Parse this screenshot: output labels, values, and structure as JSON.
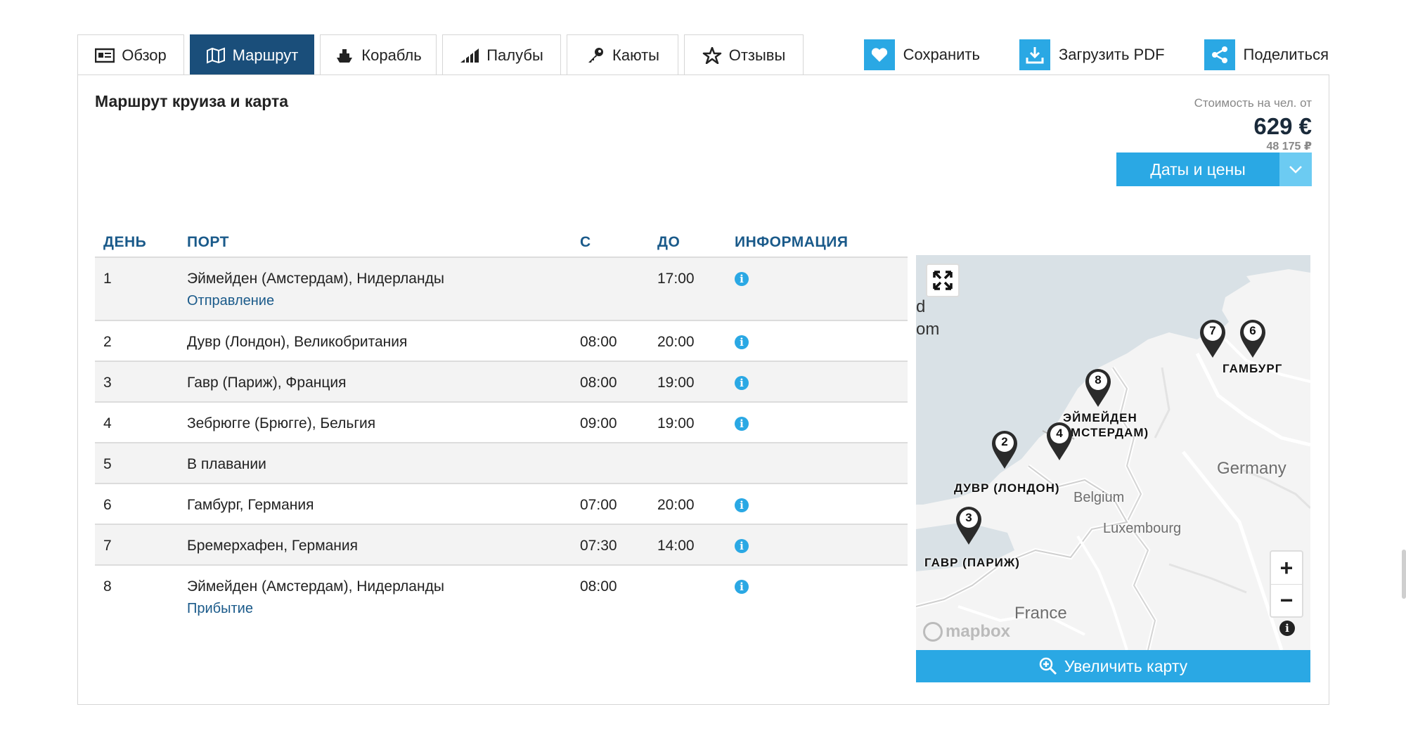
{
  "tabs": [
    {
      "label": "Обзор",
      "icon": "overview-icon",
      "active": false
    },
    {
      "label": "Маршрут",
      "icon": "map-icon",
      "active": true
    },
    {
      "label": "Корабль",
      "icon": "ship-icon",
      "active": false
    },
    {
      "label": "Палубы",
      "icon": "decks-icon",
      "active": false
    },
    {
      "label": "Каюты",
      "icon": "key-icon",
      "active": false
    },
    {
      "label": "Отзывы",
      "icon": "star-icon",
      "active": false
    }
  ],
  "actions": {
    "save": "Сохранить",
    "pdf": "Загрузить PDF",
    "share": "Поделиться"
  },
  "title": "Маршрут круиза и карта",
  "price": {
    "label": "Стоимость на чел. от",
    "main": "629 €",
    "sub": "48 175 ₽"
  },
  "dates_button": "Даты и цены",
  "table": {
    "headers": {
      "day": "ДЕНЬ",
      "port": "ПОРТ",
      "from": "С",
      "to": "ДО",
      "info": "ИНФОРМАЦИЯ"
    },
    "rows": [
      {
        "day": "1",
        "port": "Эймейден (Амстердам), Нидерланды",
        "sub": "Отправление",
        "from": "",
        "to": "17:00",
        "info": true
      },
      {
        "day": "2",
        "port": "Дувр (Лондон), Великобритания",
        "sub": "",
        "from": "08:00",
        "to": "20:00",
        "info": true
      },
      {
        "day": "3",
        "port": "Гавр (Париж), Франция",
        "sub": "",
        "from": "08:00",
        "to": "19:00",
        "info": true
      },
      {
        "day": "4",
        "port": "Зебрюгге (Брюгге), Бельгия",
        "sub": "",
        "from": "09:00",
        "to": "19:00",
        "info": true
      },
      {
        "day": "5",
        "port": "В плавании",
        "sub": "",
        "from": "",
        "to": "",
        "info": false
      },
      {
        "day": "6",
        "port": "Гамбург, Германия",
        "sub": "",
        "from": "07:00",
        "to": "20:00",
        "info": true
      },
      {
        "day": "7",
        "port": "Бремерхафен, Германия",
        "sub": "",
        "from": "07:30",
        "to": "14:00",
        "info": true
      },
      {
        "day": "8",
        "port": "Эймейден (Амстердам), Нидерланды",
        "sub": "Прибытие",
        "from": "08:00",
        "to": "",
        "info": true
      }
    ]
  },
  "map": {
    "partial_text_1": "d",
    "partial_text_2": "om",
    "labels": {
      "hamburg": "ГАМБУРГ",
      "ijmuiden_1": "ЭЙМЕЙДЕН",
      "ijmuiden_2": "(АМСТЕРДАМ)",
      "dover": "ДУВР (ЛОНДОН)",
      "havre": "ГАВР (ПАРИЖ)"
    },
    "countries": {
      "germany": "Germany",
      "belgium": "Belgium",
      "luxembourg": "Luxembourg",
      "france": "France"
    },
    "pins": {
      "p7": "7",
      "p6": "6",
      "p8": "8",
      "p2": "2",
      "p4": "4",
      "p3": "3"
    },
    "zoom_in": "+",
    "zoom_out": "−",
    "attribution": "mapbox",
    "enlarge": "Увеличить карту"
  },
  "colors": {
    "primary": "#2aa8e4",
    "tab_active": "#1a4e7a",
    "header_text": "#1a5a8a"
  }
}
